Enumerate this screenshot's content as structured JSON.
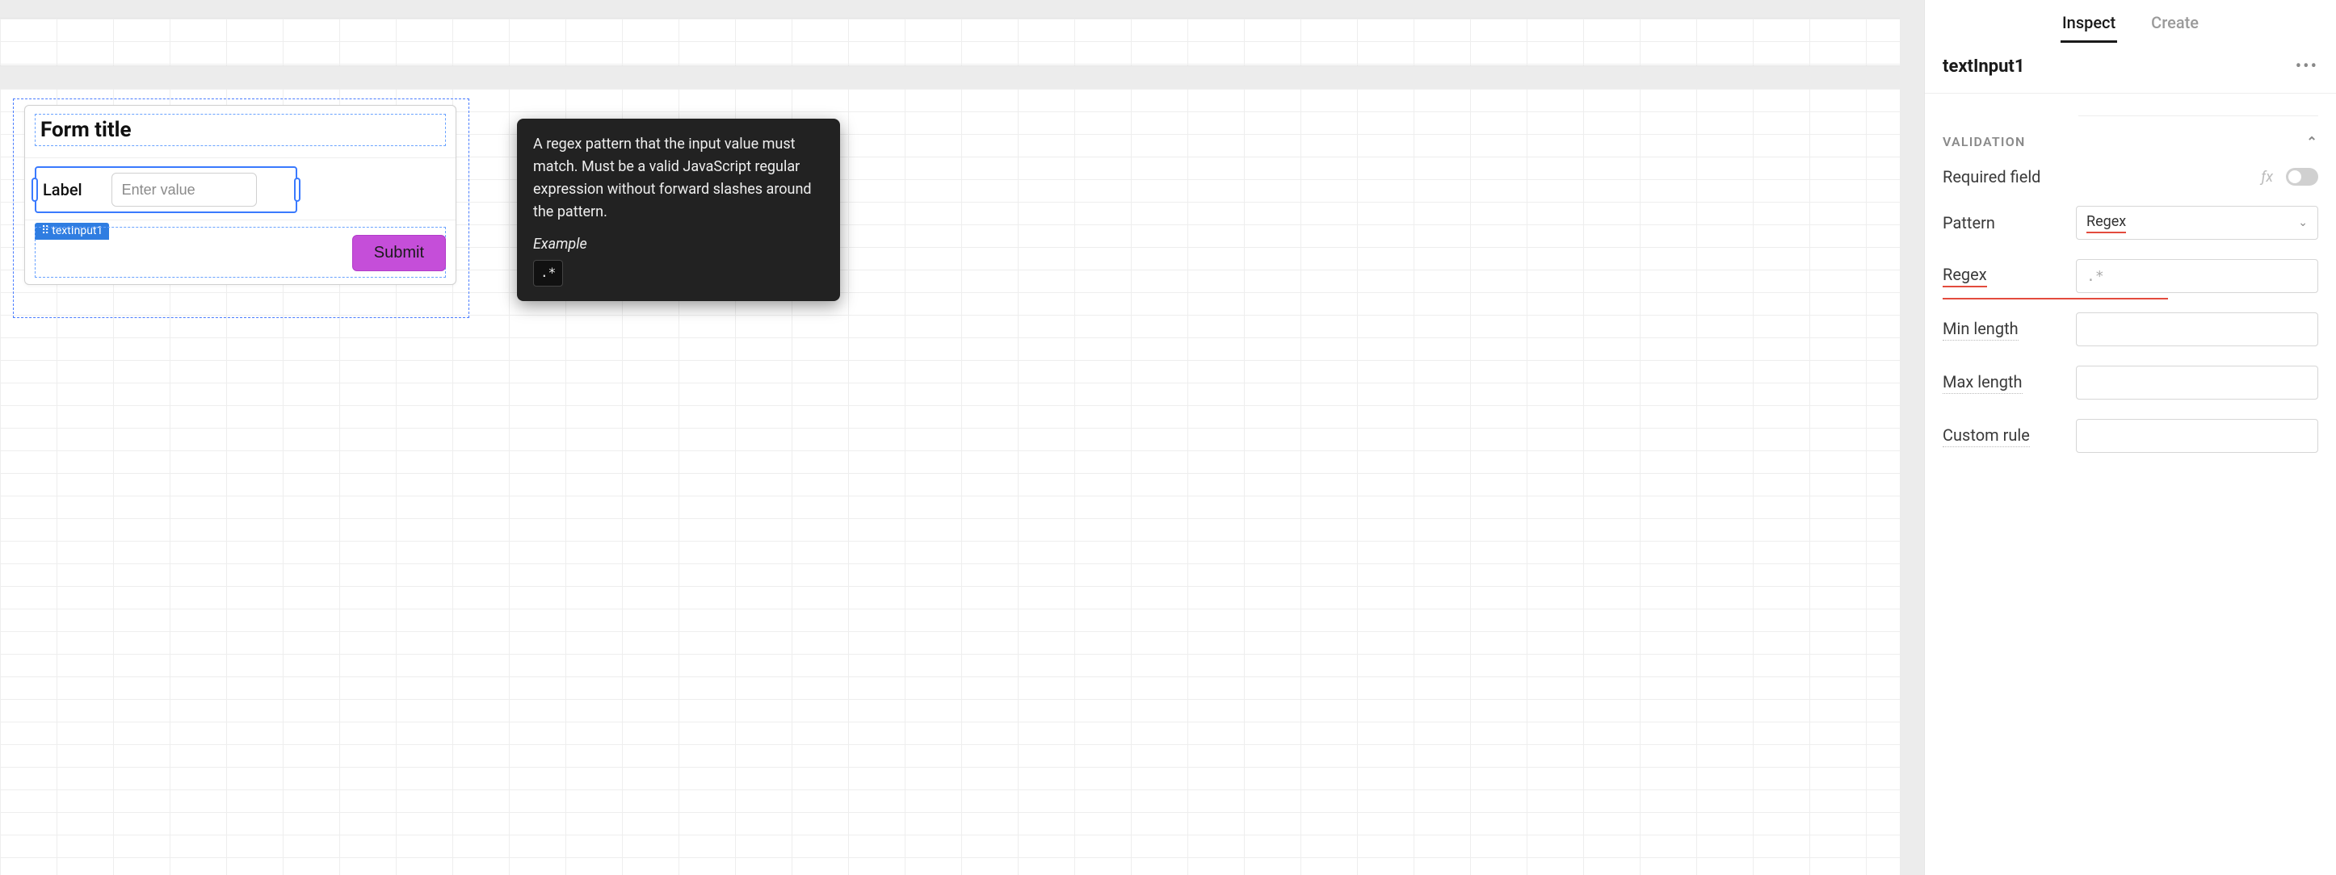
{
  "canvas": {
    "form": {
      "title": "Form title",
      "input": {
        "label": "Label",
        "placeholder": "Enter value",
        "component_tag": "textInput1"
      },
      "submit_label": "Submit"
    }
  },
  "tooltip": {
    "body": "A regex pattern that the input value must match. Must be a valid JavaScript regular expression without forward slashes around the pattern.",
    "example_label": "Example",
    "example_value": ".*"
  },
  "inspector": {
    "tabs": {
      "inspect": "Inspect",
      "create": "Create"
    },
    "component_name": "textInput1",
    "section": {
      "title": "VALIDATION",
      "rows": {
        "required_field": "Required field",
        "pattern": "Pattern",
        "pattern_value": "Regex",
        "regex": "Regex",
        "regex_placeholder": ".*",
        "min_length": "Min length",
        "max_length": "Max length",
        "custom_rule": "Custom rule"
      }
    },
    "fx_label": "ƒx"
  }
}
